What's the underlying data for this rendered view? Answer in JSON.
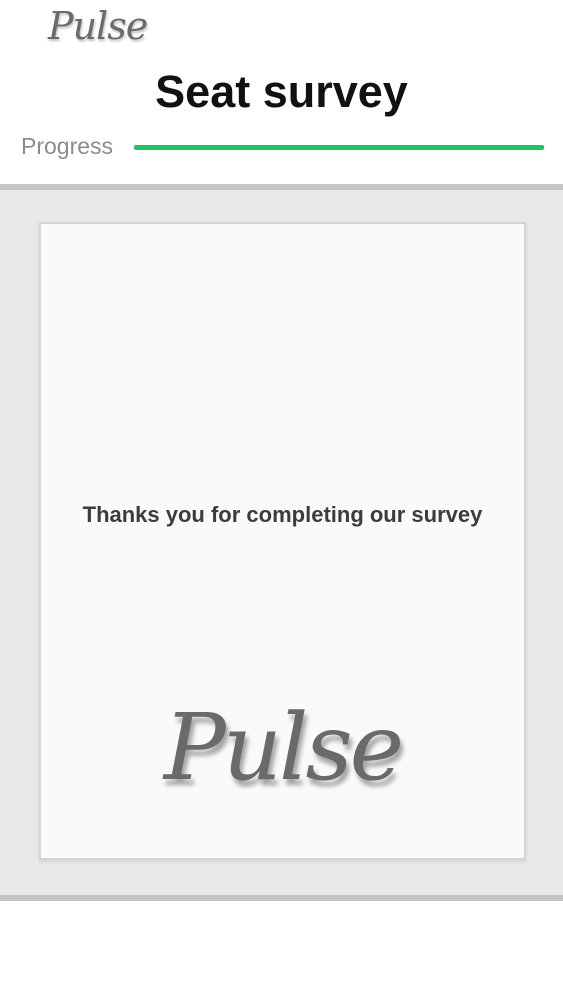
{
  "header": {
    "logo_text": "Pulse",
    "title": "Seat survey",
    "progress_label": "Progress",
    "progress_value": 1.0,
    "progress_color": "#1ec36a"
  },
  "card": {
    "message": "Thanks you for completing our survey",
    "logo_text": "Pulse"
  },
  "colors": {
    "content_background": "#e8e7ea",
    "card_background": "#faf9fb",
    "divider": "#c6c6c6"
  }
}
